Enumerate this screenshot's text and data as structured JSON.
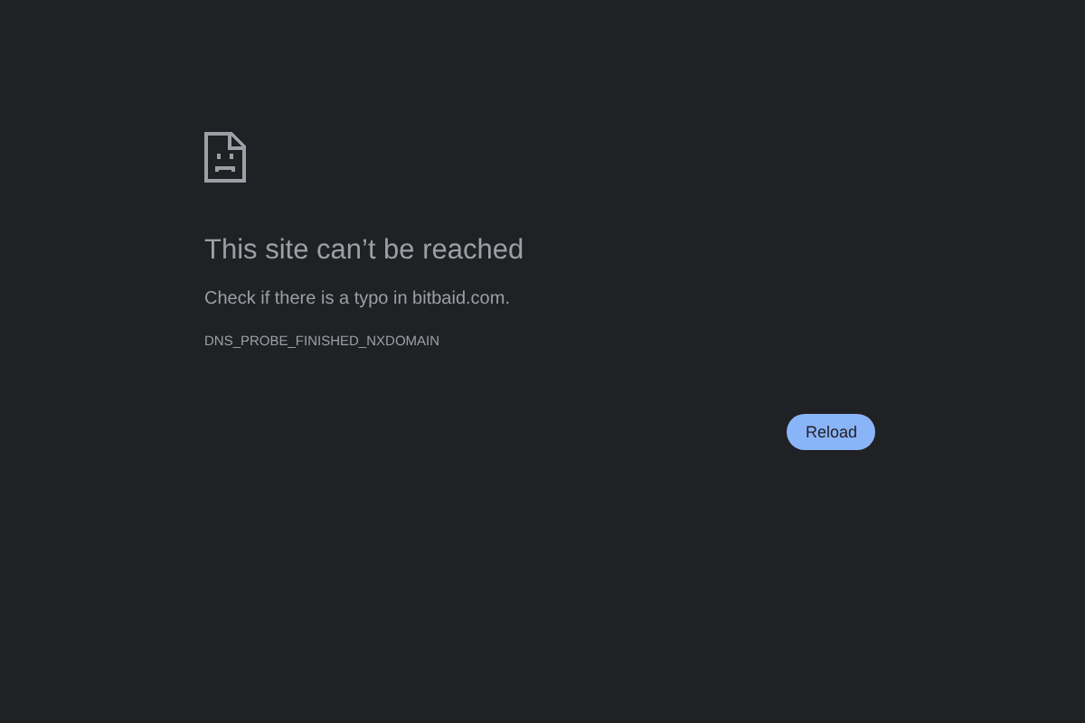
{
  "error": {
    "title": "This site can’t be reached",
    "message": "Check if there is a typo in bitbaid.com.",
    "code": "DNS_PROBE_FINISHED_NXDOMAIN"
  },
  "buttons": [
    "Reload"
  ]
}
